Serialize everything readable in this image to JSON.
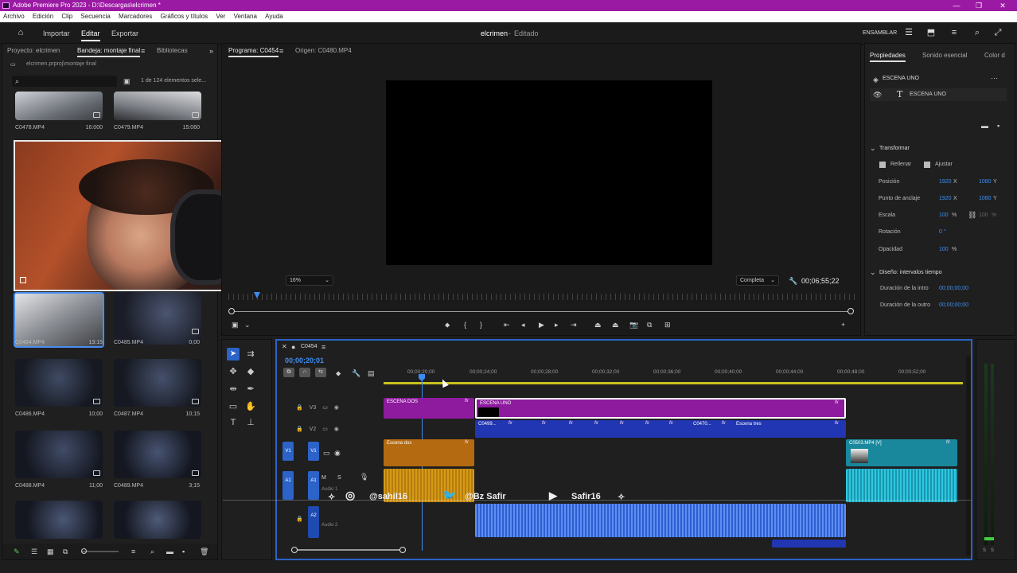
{
  "window": {
    "title": "Adobe Premiere Pro 2023 - D:\\Descargas\\elcrimen *"
  },
  "menu": [
    "Archivo",
    "Edición",
    "Clip",
    "Secuencia",
    "Marcadores",
    "Gráficos y títulos",
    "Ver",
    "Ventana",
    "Ayuda"
  ],
  "header": {
    "import": "Importar",
    "edit": "Editar",
    "export": "Exportar",
    "project_title": "elcrimen",
    "project_state": "Editado",
    "workspace_label": "ENSAMBLAR"
  },
  "project_panel": {
    "tabs": [
      "Proyecto: elcrimen",
      "Bandeja: montaje final",
      "Bibliotecas"
    ],
    "path": "elcrimen.prproj\\montaje final",
    "item_count": "1 de 124 elementos sele...",
    "items": [
      {
        "name": "C0478.MP4",
        "dur": "16:000"
      },
      {
        "name": "C0479.MP4",
        "dur": "15:060"
      },
      {
        "name": "C0484.MP4",
        "dur": "13:15"
      },
      {
        "name": "C0485.MP4",
        "dur": "0;00"
      },
      {
        "name": "C0486.MP4",
        "dur": "10;00"
      },
      {
        "name": "C0487.MP4",
        "dur": "10;15"
      },
      {
        "name": "C0488.MP4",
        "dur": "11;00"
      },
      {
        "name": "C0489.MP4",
        "dur": "3;15"
      }
    ]
  },
  "program_monitor": {
    "tab": "Programa: C0454",
    "source_tab": "Origen: C0480.MP4",
    "zoom": "16%",
    "resolution": "Completa",
    "timecode": "00;06;55;22"
  },
  "properties": {
    "tabs": [
      "Propiedades",
      "Sonido esencial",
      "Color d"
    ],
    "layer_title": "ESCENA UNO",
    "text_layer": "ESCENA UNO",
    "transform_title": "Transformar",
    "fill_label": "Rellenar",
    "fit_label": "Ajustar",
    "rows": [
      {
        "label": "Posición",
        "v1": "1920",
        "u1": "X",
        "v2": "1080",
        "u2": "Y"
      },
      {
        "label": "Punto de anclaje",
        "v1": "1920",
        "u1": "X",
        "v2": "1080",
        "u2": "Y"
      },
      {
        "label": "Escala",
        "v1": "100",
        "u1": "%",
        "v2": "100",
        "u2": "%"
      },
      {
        "label": "Rotación",
        "v1": "0 °",
        "u1": "",
        "v2": "",
        "u2": ""
      },
      {
        "label": "Opacidad",
        "v1": "100",
        "u1": "%",
        "v2": "",
        "u2": ""
      }
    ],
    "timing_title": "Diseño: intervalos tiempo",
    "timing_rows": [
      {
        "label": "Duración de la intro",
        "value": "00;00;00;00"
      },
      {
        "label": "Duración de la outro",
        "value": "00;00;00;00"
      }
    ]
  },
  "timeline": {
    "sequence": "C0454",
    "timecode": "00;00;20;01",
    "ruler": [
      "00;00;20;00",
      "00;00;24;00",
      "00;00;28;00",
      "00;00;32;00",
      "00;00;36;00",
      "00;00;40;00",
      "00;00;44;00",
      "00;00;48;00",
      "00;00;52;00"
    ],
    "tracks": {
      "v3": "V3",
      "v2": "V2",
      "v1": "V1",
      "a1": "A1",
      "a2": "A2",
      "a1_name": "Audio 1",
      "a2_name": "Audio 2"
    },
    "clips": {
      "escena_dos": "ESCENA DOS",
      "escena_uno": "ESCENA UNO",
      "c0499": "C0499...",
      "c0470": "C0470...",
      "escena_tres": "Escena tres",
      "escena_dos_v1": "Escena dos",
      "c0503": "C0503.MP4 [V]"
    },
    "fx": "fx"
  },
  "overlay": {
    "socials": [
      "@sahil16",
      "@Bz Safir",
      "Safir16"
    ]
  },
  "colors": {
    "accent": "#2b63c8",
    "title_bar": "#9b1aa3",
    "clip_purple": "#8e1a9e",
    "clip_blue": "#2136b3",
    "clip_orange": "#b36a10",
    "clip_teal": "#19889c"
  }
}
